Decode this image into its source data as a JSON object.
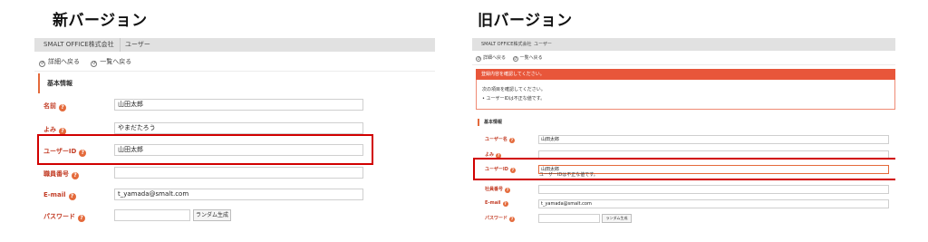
{
  "headings": {
    "new": "新バージョン",
    "old": "旧バージョン"
  },
  "new_version": {
    "topbar": {
      "company": "SMALT OFFICE株式会社",
      "page": "ユーザー"
    },
    "nav": {
      "back_detail": "詳細へ戻る",
      "back_list": "一覧へ戻る"
    },
    "section_title": "基本情報",
    "fields": {
      "name": {
        "label": "名前",
        "value": "山田太郎"
      },
      "yomi": {
        "label": "よみ",
        "value": "やまだたろう"
      },
      "user_id": {
        "label": "ユーザーID",
        "value": "山田太郎"
      },
      "employee_no": {
        "label": "職員番号",
        "value": ""
      },
      "email": {
        "label": "E-mail",
        "value": "t_yamada@smalt.com"
      },
      "password": {
        "label": "パスワード",
        "value": "",
        "button": "ランダム生成"
      }
    }
  },
  "old_version": {
    "topbar": {
      "company": "SMALT OFFICE株式会社",
      "page": "ユーザー"
    },
    "nav": {
      "back_detail": "詳細へ戻る",
      "back_list": "一覧へ戻る"
    },
    "error_banner": "登録内容を確認してください。",
    "error_intro": "次の項目を確認してください。",
    "error_item": "ユーザーIDは不正な値です。",
    "section_title": "基本情報",
    "fields": {
      "name": {
        "label": "ユーザー名",
        "value": "山田太郎"
      },
      "yomi": {
        "label": "よみ",
        "value": ""
      },
      "user_id": {
        "label": "ユーザーID",
        "value": "山田太郎",
        "error": "ユーザーIDは不正な値です。"
      },
      "employee_no": {
        "label": "社員番号",
        "value": ""
      },
      "email": {
        "label": "E-mail",
        "value": "t_yamada@smalt.com"
      },
      "password": {
        "label": "パスワード",
        "value": "",
        "button": "ランダム生成"
      }
    }
  },
  "colors": {
    "accent": "#e46a3b",
    "label": "#c33e27",
    "highlight": "#d10000",
    "error_banner": "#e8563a"
  },
  "icons": {
    "help": "?",
    "nav": "circle-arrow-icon"
  }
}
